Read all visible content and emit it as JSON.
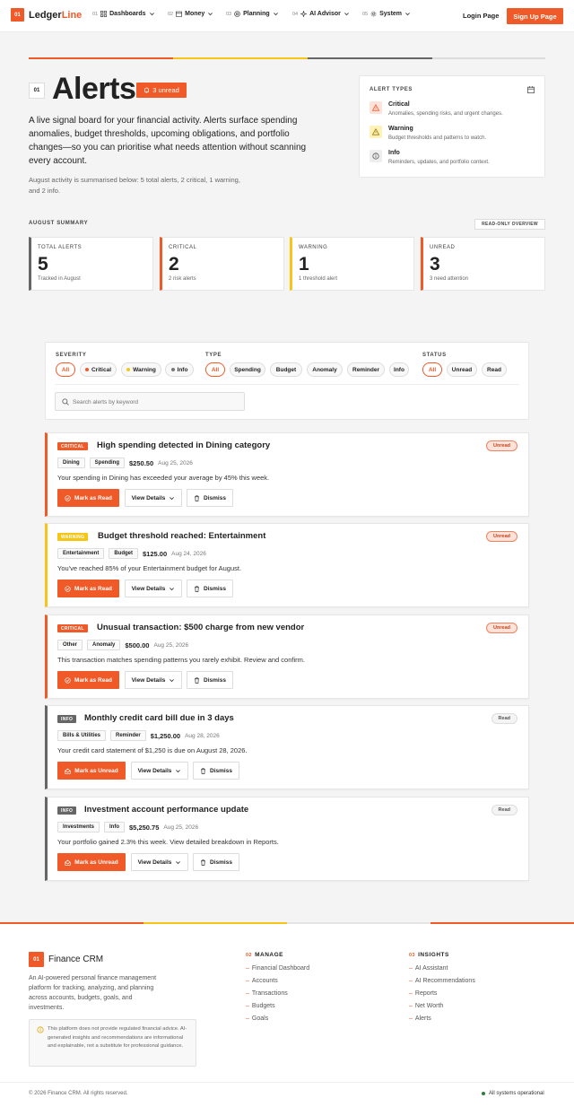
{
  "colors": {
    "accent": "#f05a28",
    "critical": "#f05a28",
    "warning": "#f5c518",
    "info": "#666666"
  },
  "nav": {
    "logo_num": "01",
    "logo_text": "Ledger",
    "logo_accent": "Line",
    "items": [
      {
        "num": "01",
        "label": "Dashboards",
        "icon": "grid-icon"
      },
      {
        "num": "02",
        "label": "Money",
        "icon": "wallet-icon"
      },
      {
        "num": "03",
        "label": "Planning",
        "icon": "target-icon"
      },
      {
        "num": "04",
        "label": "AI Advisor",
        "icon": "sparkle-icon"
      },
      {
        "num": "05",
        "label": "System",
        "icon": "gear-icon"
      }
    ],
    "login": "Login Page",
    "signup": "Sign Up Page"
  },
  "hero": {
    "num": "01",
    "title": "Alerts",
    "unread_badge": "3 unread",
    "lead": "A live signal board for your financial activity. Alerts surface spending anomalies, budget thresholds, upcoming obligations, and portfolio changes—so you can prioritise what needs attention without scanning every account.",
    "sub": "August activity is summarised below: 5 total alerts, 2 critical, 1 warning, and 2 info."
  },
  "alert_types": {
    "header": "ALERT TYPES",
    "items": [
      {
        "name": "Critical",
        "desc": "Anomalies, spending risks, and urgent changes."
      },
      {
        "name": "Warning",
        "desc": "Budget thresholds and patterns to watch."
      },
      {
        "name": "Info",
        "desc": "Reminders, updates, and portfolio context."
      }
    ]
  },
  "summary": {
    "label": "AUGUST SUMMARY",
    "badge": "READ-ONLY OVERVIEW",
    "cards": [
      {
        "label": "TOTAL ALERTS",
        "value": "5",
        "sub": "Tracked in August"
      },
      {
        "label": "CRITICAL",
        "value": "2",
        "sub": "2 risk alerts"
      },
      {
        "label": "WARNING",
        "value": "1",
        "sub": "1 threshold alert"
      },
      {
        "label": "UNREAD",
        "value": "3",
        "sub": "3 need attention"
      }
    ]
  },
  "filters": {
    "severity_label": "SEVERITY",
    "severity": [
      "All",
      "Critical",
      "Warning",
      "Info"
    ],
    "type_label": "TYPE",
    "type": [
      "All",
      "Spending",
      "Budget",
      "Anomaly",
      "Reminder",
      "Info"
    ],
    "status_label": "STATUS",
    "status": [
      "All",
      "Unread",
      "Read"
    ],
    "search_placeholder": "Search alerts by keyword"
  },
  "alerts": [
    {
      "severity": "CRITICAL",
      "title": "High spending detected in Dining category",
      "status": "Unread",
      "tags": [
        "Dining",
        "Spending"
      ],
      "amount": "$250.50",
      "date": "Aug 25, 2026",
      "desc": "Your spending in Dining has exceeded your average by 45% this week.",
      "primary": "Mark as Read",
      "details": "View Details",
      "dismiss": "Dismiss"
    },
    {
      "severity": "WARNING",
      "title": "Budget threshold reached: Entertainment",
      "status": "Unread",
      "tags": [
        "Entertainment",
        "Budget"
      ],
      "amount": "$125.00",
      "date": "Aug 24, 2026",
      "desc": "You've reached 85% of your Entertainment budget for August.",
      "primary": "Mark as Read",
      "details": "View Details",
      "dismiss": "Dismiss"
    },
    {
      "severity": "CRITICAL",
      "title": "Unusual transaction: $500 charge from new vendor",
      "status": "Unread",
      "tags": [
        "Other",
        "Anomaly"
      ],
      "amount": "$500.00",
      "date": "Aug 25, 2026",
      "desc": "This transaction matches spending patterns you rarely exhibit. Review and confirm.",
      "primary": "Mark as Read",
      "details": "View Details",
      "dismiss": "Dismiss"
    },
    {
      "severity": "INFO",
      "title": "Monthly credit card bill due in 3 days",
      "status": "Read",
      "tags": [
        "Bills & Utilities",
        "Reminder"
      ],
      "amount": "$1,250.00",
      "date": "Aug 28, 2026",
      "desc": "Your credit card statement of $1,250 is due on August 28, 2026.",
      "primary": "Mark as Unread",
      "details": "View Details",
      "dismiss": "Dismiss"
    },
    {
      "severity": "INFO",
      "title": "Investment account performance update",
      "status": "Read",
      "tags": [
        "Investments",
        "Info"
      ],
      "amount": "$5,250.75",
      "date": "Aug 25, 2026",
      "desc": "Your portfolio gained 2.3% this week. View detailed breakdown in Reports.",
      "primary": "Mark as Unread",
      "details": "View Details",
      "dismiss": "Dismiss"
    }
  ],
  "footer": {
    "num": "01",
    "name": "Finance CRM",
    "desc": "An AI-powered personal finance management platform for tracking, analyzing, and planning across accounts, budgets, goals, and investments.",
    "disclaimer": "This platform does not provide regulated financial advice. AI-generated insights and recommendations are informational and explainable, not a substitute for professional guidance.",
    "manage_num": "02",
    "manage_label": "MANAGE",
    "manage": [
      "Financial Dashboard",
      "Accounts",
      "Transactions",
      "Budgets",
      "Goals"
    ],
    "insights_num": "03",
    "insights_label": "INSIGHTS",
    "insights": [
      "AI Assistant",
      "AI Recommendations",
      "Reports",
      "Net Worth",
      "Alerts"
    ],
    "copyright": "© 2026 Finance CRM. All rights reserved.",
    "status": "All systems operational"
  }
}
